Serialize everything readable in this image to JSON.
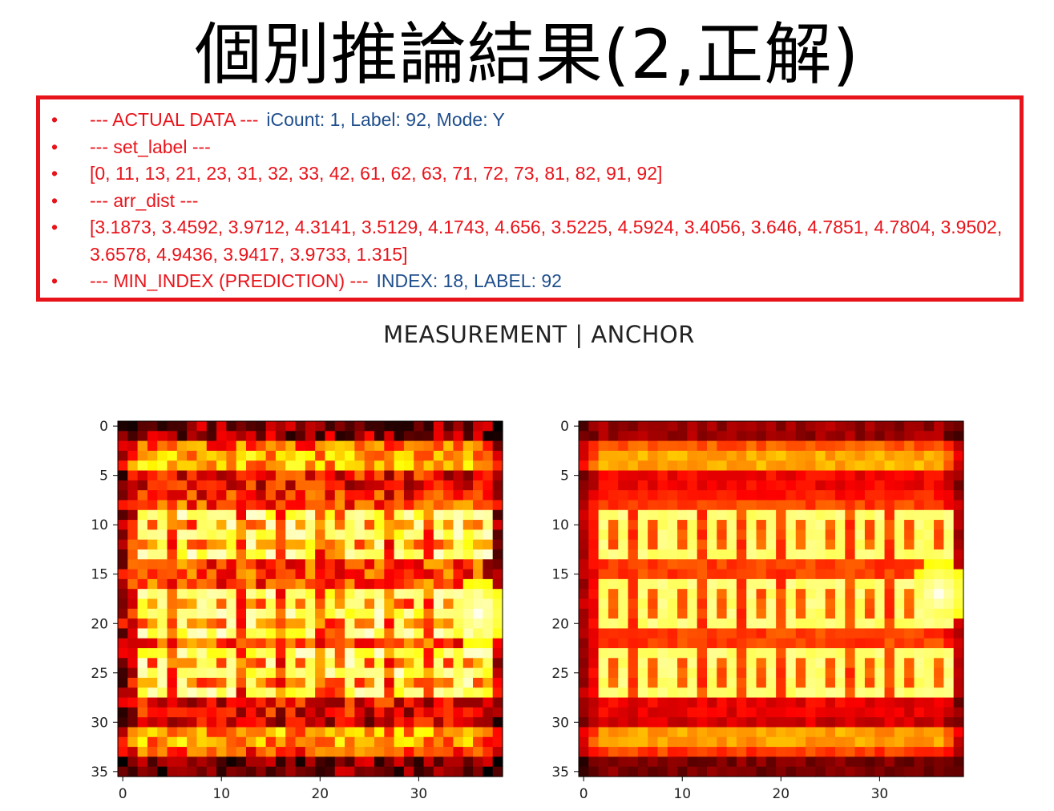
{
  "title": "個別推論結果(2,正解)",
  "info": {
    "items": [
      {
        "text": "--- ACTUAL DATA ---",
        "extra": "iCount: 1, Label: 92, Mode: Y"
      },
      {
        "text": "--- set_label ---",
        "extra": ""
      },
      {
        "text": "[0, 11, 13, 21, 23, 31, 32, 33, 42, 61, 62, 63, 71, 72, 73, 81, 82, 91, 92]",
        "extra": ""
      },
      {
        "text": "--- arr_dist ---",
        "extra": ""
      },
      {
        "text": "[3.1873, 3.4592, 3.9712, 4.3141, 3.5129, 4.1743, 4.656, 3.5225, 4.5924, 3.4056, 3.646, 4.7851, 4.7804, 3.9502, 3.6578, 4.9436, 3.9417, 3.9733, 1.315]",
        "extra": ""
      },
      {
        "text": "--- MIN_INDEX (PREDICTION) ---",
        "extra": "INDEX: 18, LABEL: 92"
      }
    ],
    "bullet": "•",
    "border_color": "#e8141b",
    "text_color": "#e8141b",
    "highlight_color": "#1f4e8c"
  },
  "plot_title": "MEASUREMENT  |  ANCHOR",
  "chart_data": [
    {
      "type": "heatmap",
      "name": "MEASUREMENT",
      "colormap": "hot",
      "rows": 36,
      "cols": 39,
      "xlim": [
        -0.5,
        38.5
      ],
      "ylim": [
        35.5,
        -0.5
      ],
      "xticks": [
        0,
        10,
        20,
        30
      ],
      "yticks": [
        0,
        5,
        10,
        15,
        20,
        25,
        30,
        35
      ],
      "digit_text": "9292949292",
      "digit_bands": [
        9,
        17,
        23
      ],
      "bright_blob": {
        "col": 36,
        "row": 19
      },
      "noise": 0.25
    },
    {
      "type": "heatmap",
      "name": "ANCHOR",
      "colormap": "hot",
      "rows": 36,
      "cols": 39,
      "xlim": [
        -0.5,
        38.5
      ],
      "ylim": [
        35.5,
        -0.5
      ],
      "xticks": [
        0,
        10,
        20,
        30
      ],
      "yticks": [
        0,
        5,
        10,
        15,
        20,
        25,
        30,
        35
      ],
      "digit_text": "0000000000",
      "digit_bands": [
        9,
        16,
        23
      ],
      "bright_blob": {
        "col": 36,
        "row": 17
      },
      "noise": 0.08
    }
  ]
}
